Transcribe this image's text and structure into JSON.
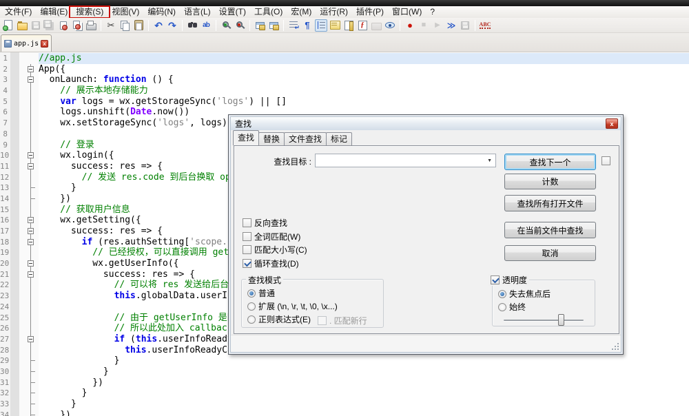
{
  "menubar": {
    "items": [
      "文件(F)",
      "编辑(E)",
      "搜索(S)",
      "视图(V)",
      "编码(N)",
      "语言(L)",
      "设置(T)",
      "工具(O)",
      "宏(M)",
      "运行(R)",
      "插件(P)",
      "窗口(W)",
      "?"
    ],
    "highlighted_item": "搜索(S)",
    "highlight_color": "#C90D07"
  },
  "toolbar": {
    "icons": [
      {
        "name": "new-file"
      },
      {
        "name": "open-file"
      },
      {
        "name": "save",
        "disabled": true
      },
      {
        "name": "save-all",
        "disabled": true
      },
      {
        "name": "close-file"
      },
      {
        "name": "close-all"
      },
      {
        "name": "print"
      },
      {
        "sep": true
      },
      {
        "name": "cut"
      },
      {
        "name": "copy"
      },
      {
        "name": "paste"
      },
      {
        "sep": true
      },
      {
        "name": "undo"
      },
      {
        "name": "redo"
      },
      {
        "sep": true
      },
      {
        "name": "find"
      },
      {
        "name": "replace"
      },
      {
        "sep": true
      },
      {
        "name": "zoom-in"
      },
      {
        "name": "zoom-out"
      },
      {
        "sep": true
      },
      {
        "name": "sync-vertical"
      },
      {
        "name": "sync-horizontal"
      },
      {
        "sep": true
      },
      {
        "name": "word-wrap"
      },
      {
        "name": "show-all-chars"
      },
      {
        "name": "indent-guide",
        "selected": true
      },
      {
        "name": "user-dialog"
      },
      {
        "name": "doc-map"
      },
      {
        "name": "function-list"
      },
      {
        "name": "folder-workspace",
        "disabled": true
      },
      {
        "name": "monitoring"
      },
      {
        "sep": true
      },
      {
        "name": "macro-record"
      },
      {
        "name": "macro-stop",
        "disabled": true
      },
      {
        "name": "macro-play",
        "disabled": true
      },
      {
        "name": "macro-run-multiple"
      },
      {
        "name": "macro-save",
        "disabled": true
      },
      {
        "sep": true
      },
      {
        "name": "spell-check"
      }
    ],
    "glyphs": {
      "cut": "✂",
      "undo": "↶",
      "redo": "↷",
      "replace": "ab",
      "word-wrap": "↵",
      "show-all-chars": "¶",
      "function-list": "ƒ",
      "macro-record": "●",
      "macro-stop": "■",
      "macro-play": "▶",
      "macro-run-multiple": "≫",
      "spell-check": "ABC"
    }
  },
  "tabbar": {
    "tabs": [
      {
        "label": "app.js",
        "active": true
      }
    ]
  },
  "editor": {
    "current_line": 1,
    "lines": [
      {
        "num": 1,
        "fold": "",
        "tokens": [
          [
            "c",
            "//app.js"
          ]
        ]
      },
      {
        "num": 2,
        "fold": "box",
        "tokens": [
          [
            "p",
            "App({"
          ]
        ]
      },
      {
        "num": 3,
        "fold": "box",
        "tokens": [
          [
            "p",
            "  onLaunch: "
          ],
          [
            "k",
            "function"
          ],
          [
            "p",
            " () {"
          ]
        ]
      },
      {
        "num": 4,
        "fold": "vert",
        "tokens": [
          [
            "c",
            "    // 展示本地存储能力"
          ]
        ]
      },
      {
        "num": 5,
        "fold": "vert",
        "tokens": [
          [
            "p",
            "    "
          ],
          [
            "k",
            "var"
          ],
          [
            "p",
            " logs = wx.getStorageSync("
          ],
          [
            "s",
            "'logs'"
          ],
          [
            "p",
            ") || []"
          ]
        ]
      },
      {
        "num": 6,
        "fold": "vert",
        "tokens": [
          [
            "p",
            "    logs.unshift("
          ],
          [
            "t",
            "Date"
          ],
          [
            "p",
            ".now())"
          ]
        ]
      },
      {
        "num": 7,
        "fold": "vert",
        "tokens": [
          [
            "p",
            "    wx.setStorageSync("
          ],
          [
            "s",
            "'logs'"
          ],
          [
            "p",
            ", logs)"
          ]
        ]
      },
      {
        "num": 8,
        "fold": "vert",
        "tokens": []
      },
      {
        "num": 9,
        "fold": "vert",
        "tokens": [
          [
            "c",
            "    // 登录"
          ]
        ]
      },
      {
        "num": 10,
        "fold": "box",
        "tokens": [
          [
            "p",
            "    wx.login({"
          ]
        ]
      },
      {
        "num": 11,
        "fold": "box",
        "tokens": [
          [
            "p",
            "      success: res => {"
          ]
        ]
      },
      {
        "num": 12,
        "fold": "vert",
        "tokens": [
          [
            "c",
            "        // 发送 res.code 到后台换取 openId, sessionKey, unionId"
          ]
        ]
      },
      {
        "num": 13,
        "fold": "tee",
        "tokens": [
          [
            "p",
            "      }"
          ]
        ]
      },
      {
        "num": 14,
        "fold": "tee",
        "tokens": [
          [
            "p",
            "    })"
          ]
        ]
      },
      {
        "num": 15,
        "fold": "vert",
        "tokens": [
          [
            "c",
            "    // 获取用户信息"
          ]
        ]
      },
      {
        "num": 16,
        "fold": "box",
        "tokens": [
          [
            "p",
            "    wx.getSetting({"
          ]
        ]
      },
      {
        "num": 17,
        "fold": "box",
        "tokens": [
          [
            "p",
            "      success: res => {"
          ]
        ]
      },
      {
        "num": 18,
        "fold": "box",
        "tokens": [
          [
            "p",
            "        "
          ],
          [
            "k",
            "if"
          ],
          [
            "p",
            " (res.authSetting["
          ],
          [
            "s",
            "'scope.userInfo'"
          ],
          [
            "p",
            "]) {"
          ]
        ]
      },
      {
        "num": 19,
        "fold": "vert",
        "tokens": [
          [
            "c",
            "          // 已经授权，可以直接调用 getUserInfo 获取头像昵称，不会弹框"
          ]
        ]
      },
      {
        "num": 20,
        "fold": "box",
        "tokens": [
          [
            "p",
            "          wx.getUserInfo({"
          ]
        ]
      },
      {
        "num": 21,
        "fold": "box",
        "tokens": [
          [
            "p",
            "            success: res => {"
          ]
        ]
      },
      {
        "num": 22,
        "fold": "vert",
        "tokens": [
          [
            "c",
            "              // 可以将 res 发送给后台解码出 unionId"
          ]
        ]
      },
      {
        "num": 23,
        "fold": "vert",
        "tokens": [
          [
            "p",
            "              "
          ],
          [
            "k",
            "this"
          ],
          [
            "p",
            ".globalData.userInfo = res.userInfo"
          ]
        ]
      },
      {
        "num": 24,
        "fold": "vert",
        "tokens": []
      },
      {
        "num": 25,
        "fold": "vert",
        "tokens": [
          [
            "c",
            "              // 由于 getUserInfo 是网络请求，可能会在 Page.onLoad 之后才返回"
          ]
        ]
      },
      {
        "num": 26,
        "fold": "vert",
        "tokens": [
          [
            "c",
            "              // 所以此处加入 callback 以防止这种情况"
          ]
        ]
      },
      {
        "num": 27,
        "fold": "box",
        "tokens": [
          [
            "p",
            "              "
          ],
          [
            "k",
            "if"
          ],
          [
            "p",
            " ("
          ],
          [
            "k",
            "this"
          ],
          [
            "p",
            ".userInfoReadyCallback) {"
          ]
        ]
      },
      {
        "num": 28,
        "fold": "vert",
        "tokens": [
          [
            "p",
            "                "
          ],
          [
            "k",
            "this"
          ],
          [
            "p",
            ".userInfoReadyCallback(res)"
          ]
        ]
      },
      {
        "num": 29,
        "fold": "tee",
        "tokens": [
          [
            "p",
            "              }"
          ]
        ]
      },
      {
        "num": 30,
        "fold": "tee",
        "tokens": [
          [
            "p",
            "            }"
          ]
        ]
      },
      {
        "num": 31,
        "fold": "tee",
        "tokens": [
          [
            "p",
            "          })"
          ]
        ]
      },
      {
        "num": 32,
        "fold": "tee",
        "tokens": [
          [
            "p",
            "        }"
          ]
        ]
      },
      {
        "num": 33,
        "fold": "tee",
        "tokens": [
          [
            "p",
            "      }"
          ]
        ]
      },
      {
        "num": 34,
        "fold": "tee",
        "tokens": [
          [
            "p",
            "    })"
          ]
        ]
      }
    ]
  },
  "find_dialog": {
    "title": "查找",
    "close_glyph": "x",
    "tabs": [
      {
        "label": "查找",
        "active": true
      },
      {
        "label": "替换",
        "active": false
      },
      {
        "label": "文件查找",
        "active": false
      },
      {
        "label": "标记",
        "active": false
      }
    ],
    "find_target_label": "查找目标 :",
    "find_target_value": "",
    "combo_arrow": "▼",
    "buttons": [
      {
        "label": "查找下一个",
        "default": true
      },
      {
        "label": "计数",
        "default": false
      },
      {
        "label": "查找所有打开文件",
        "default": false
      },
      {
        "label": "在当前文件中查找",
        "default": false
      },
      {
        "label": "取消",
        "default": false
      }
    ],
    "options": [
      {
        "label": "反向查找",
        "checked": false
      },
      {
        "label": "全词匹配(W)",
        "checked": false
      },
      {
        "label": "匹配大小写(C)",
        "checked": false
      },
      {
        "label": "循环查找(D)",
        "checked": true
      }
    ],
    "search_mode": {
      "title": "查找模式",
      "options": [
        {
          "label": "普通",
          "selected": true
        },
        {
          "label": "扩展 (\\n, \\r, \\t, \\0, \\x...)",
          "selected": false
        },
        {
          "label": "正则表达式(E)",
          "selected": false
        }
      ],
      "matches_newline": {
        "label": ". 匹配新行",
        "checked": false,
        "disabled": true
      }
    },
    "transparency": {
      "label": "透明度",
      "checked": true,
      "options": [
        {
          "label": "失去焦点后",
          "selected": true
        },
        {
          "label": "始终",
          "selected": false
        }
      ],
      "slider_percent": 74
    }
  }
}
